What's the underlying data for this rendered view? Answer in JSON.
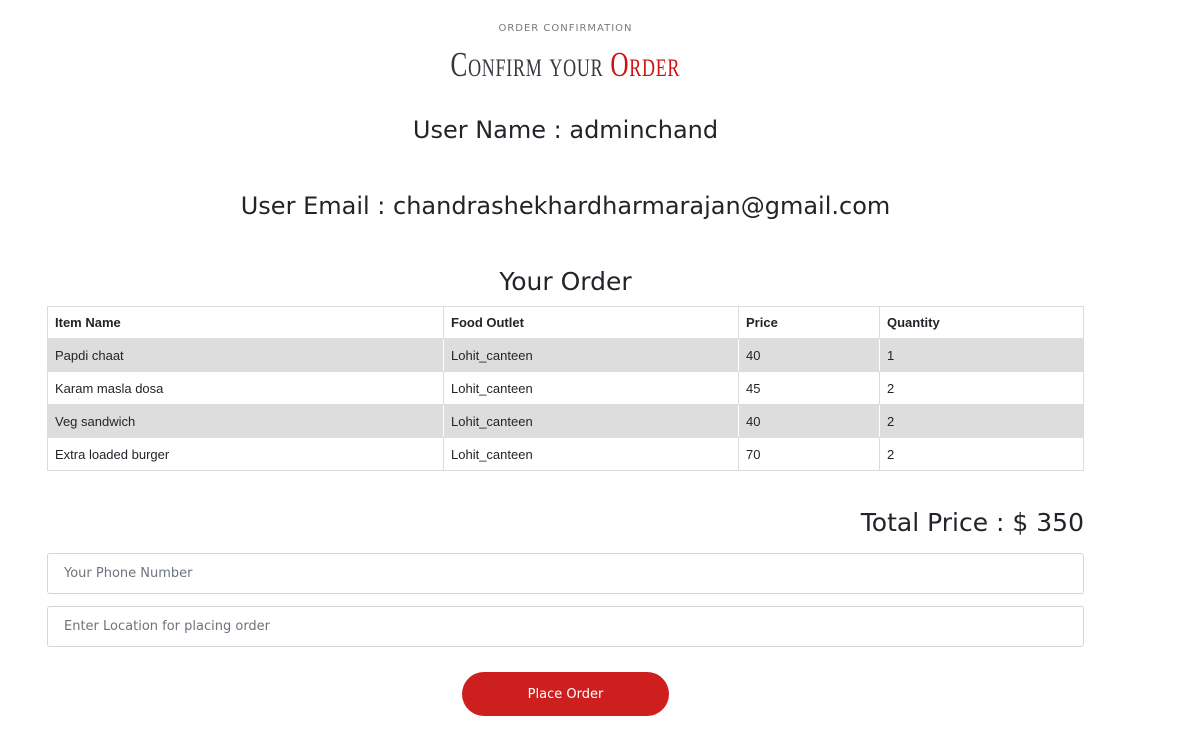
{
  "header": {
    "eyebrow": "Order Confirmation",
    "title_main": "Confirm your ",
    "title_accent": "Order"
  },
  "user": {
    "name_line": "User Name : adminchand",
    "email_line": "User Email : chandrashekhardharmarajan@gmail.com"
  },
  "order": {
    "heading": "Your Order",
    "columns": [
      "Item Name",
      "Food Outlet",
      "Price",
      "Quantity"
    ],
    "rows": [
      {
        "item": "Papdi chaat",
        "outlet": "Lohit_canteen",
        "price": "40",
        "quantity": "1"
      },
      {
        "item": "Karam masla dosa",
        "outlet": "Lohit_canteen",
        "price": "45",
        "quantity": "2"
      },
      {
        "item": "Veg sandwich",
        "outlet": "Lohit_canteen",
        "price": "40",
        "quantity": "2"
      },
      {
        "item": "Extra loaded burger",
        "outlet": "Lohit_canteen",
        "price": "70",
        "quantity": "2"
      }
    ],
    "total_line": "Total Price : $ 350"
  },
  "form": {
    "phone_placeholder": "Your Phone Number",
    "phone_value": "",
    "location_placeholder": "Enter Location for placing order",
    "location_value": "",
    "submit_label": "Place Order"
  },
  "colors": {
    "accent": "#ce1212",
    "button": "#ce1f1f",
    "row_stripe": "#dddddd"
  }
}
